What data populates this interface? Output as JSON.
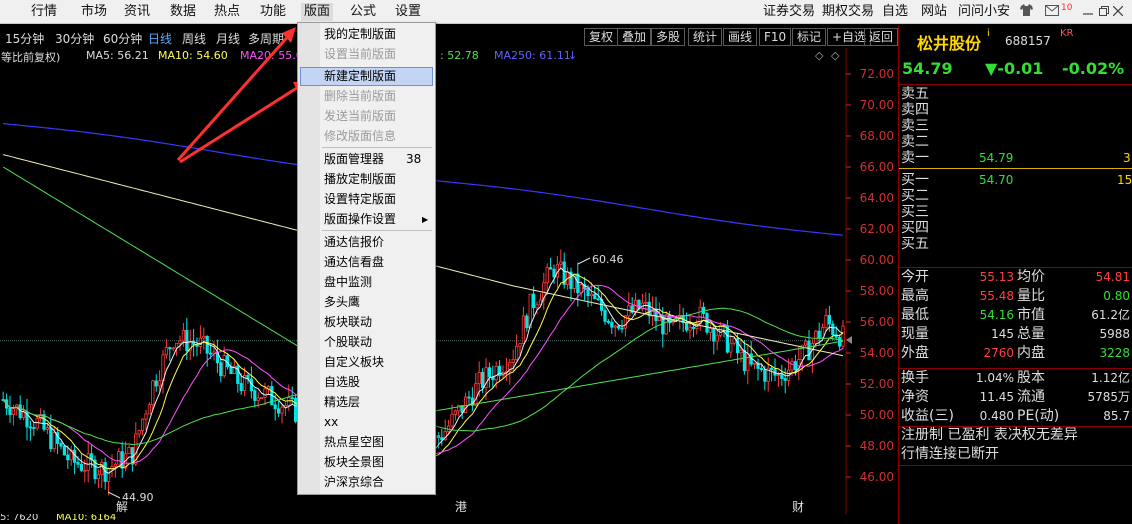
{
  "menu": {
    "left": [
      "行情",
      "市场",
      "资讯",
      "数据",
      "热点",
      "功能",
      "版面",
      "公式",
      "设置"
    ],
    "right": [
      "证券交易",
      "期权交易",
      "自选",
      "网站",
      "问问小安"
    ],
    "icons": [
      "shirt-icon",
      "envelope-icon",
      "minimize-icon",
      "restore-icon",
      "close-icon"
    ]
  },
  "toolbar": {
    "periods": [
      "15分钟",
      "30分钟",
      "60分钟",
      "日线",
      "周线",
      "月线",
      "多周期"
    ],
    "selected_period": "日线",
    "right_buttons": [
      "复权",
      "叠加",
      "多股",
      "统计",
      "画线",
      "F10",
      "标记",
      "+自选",
      "返回"
    ]
  },
  "ma_line": {
    "prefix": "等比前复权)",
    "ma5": "MA5: 56.21",
    "ma10": "MA10: 54.60",
    "ma20": "MA20: 55.0",
    "ma60_tail": ": 52.78",
    "ma250": "MA250: 61.11"
  },
  "dropdown": {
    "items": [
      {
        "label": "我的定制版面",
        "state": "normal"
      },
      {
        "label": "设置当前版面",
        "state": "disabled"
      },
      {
        "label": "新建定制版面",
        "state": "highlighted"
      },
      {
        "label": "删除当前版面",
        "state": "disabled"
      },
      {
        "label": "发送当前版面",
        "state": "disabled"
      },
      {
        "label": "修改版面信息",
        "state": "disabled"
      },
      {
        "label": "版面管理器",
        "state": "normal",
        "count": "38"
      },
      {
        "label": "播放定制版面",
        "state": "normal"
      },
      {
        "label": "设置特定版面",
        "state": "normal"
      },
      {
        "label": "版面操作设置",
        "state": "normal",
        "submenu": true
      },
      {
        "label": "通达信报价",
        "state": "normal"
      },
      {
        "label": "通达信看盘",
        "state": "normal"
      },
      {
        "label": "盘中监测",
        "state": "normal"
      },
      {
        "label": "多头鹰",
        "state": "normal"
      },
      {
        "label": "板块联动",
        "state": "normal"
      },
      {
        "label": "个股联动",
        "state": "normal"
      },
      {
        "label": "自定义板块",
        "state": "normal"
      },
      {
        "label": "自选股",
        "state": "normal"
      },
      {
        "label": "精选层",
        "state": "normal"
      },
      {
        "label": "xx",
        "state": "normal"
      },
      {
        "label": "热点星空图",
        "state": "normal"
      },
      {
        "label": "板块全景图",
        "state": "normal"
      },
      {
        "label": "沪深京综合",
        "state": "normal"
      }
    ]
  },
  "chart": {
    "price_ticks": [
      "72.00",
      "70.00",
      "68.00",
      "66.00",
      "64.00",
      "62.00",
      "60.00",
      "58.00",
      "56.00",
      "54.00",
      "52.00",
      "50.00",
      "48.00",
      "46.00"
    ],
    "high_label": "60.46",
    "low_label": "44.90",
    "markers": [
      "解",
      "港",
      "财"
    ],
    "colors": {
      "up": "#ff3c3c",
      "down": "#00e6e6",
      "ma5": "#f0f0f0",
      "ma10": "#ffff50",
      "ma20": "#ff50ff",
      "ma60": "#50e050",
      "ma250": "#3838ff",
      "ma_long": "#f0f0b4"
    }
  },
  "bottom": {
    "left": "5: 7620",
    "ma10": "MA10: 6164"
  },
  "panel": {
    "name": "松井股份",
    "tag_i": "i",
    "code": "688157",
    "tag_kr": "KR",
    "price": "54.79",
    "change": "▼-0.01",
    "pct": "-0.02%",
    "sell_labels": [
      "卖五",
      "卖四",
      "卖三",
      "卖二",
      "卖一"
    ],
    "sell1_price": "54.79",
    "sell1_vol": "3",
    "buy_labels": [
      "买一",
      "买二",
      "买三",
      "买四",
      "买五"
    ],
    "buy1_price": "54.70",
    "buy1_vol": "15",
    "stats": [
      {
        "l1": "今开",
        "v1": "55.13",
        "c1": "#ff4040",
        "l2": "均价",
        "v2": "54.81",
        "c2": "#ff4040"
      },
      {
        "l1": "最高",
        "v1": "55.48",
        "c1": "#ff4040",
        "l2": "量比",
        "v2": "0.80",
        "c2": "#33dd33"
      },
      {
        "l1": "最低",
        "v1": "54.16",
        "c1": "#33dd33",
        "l2": "市值",
        "v2": "61.2亿",
        "c2": "#dddddd"
      },
      {
        "l1": "现量",
        "v1": "145",
        "c1": "#dddddd",
        "l2": "总量",
        "v2": "5988",
        "c2": "#dddddd"
      },
      {
        "l1": "外盘",
        "v1": "2760",
        "c1": "#ff4040",
        "l2": "内盘",
        "v2": "3228",
        "c2": "#33dd33"
      }
    ],
    "stats2": [
      {
        "l1": "换手",
        "v1": "1.04%",
        "l2": "股本",
        "v2": "1.12亿"
      },
      {
        "l1": "净资",
        "v1": "11.45",
        "l2": "流通",
        "v2": "5785万"
      },
      {
        "l1": "收益(三)",
        "v1": "0.480",
        "l2": "PE(动)",
        "v2": "85.7"
      }
    ],
    "note1": "注册制 已盈利 表决权无差异",
    "note2": "行情连接已断开"
  }
}
